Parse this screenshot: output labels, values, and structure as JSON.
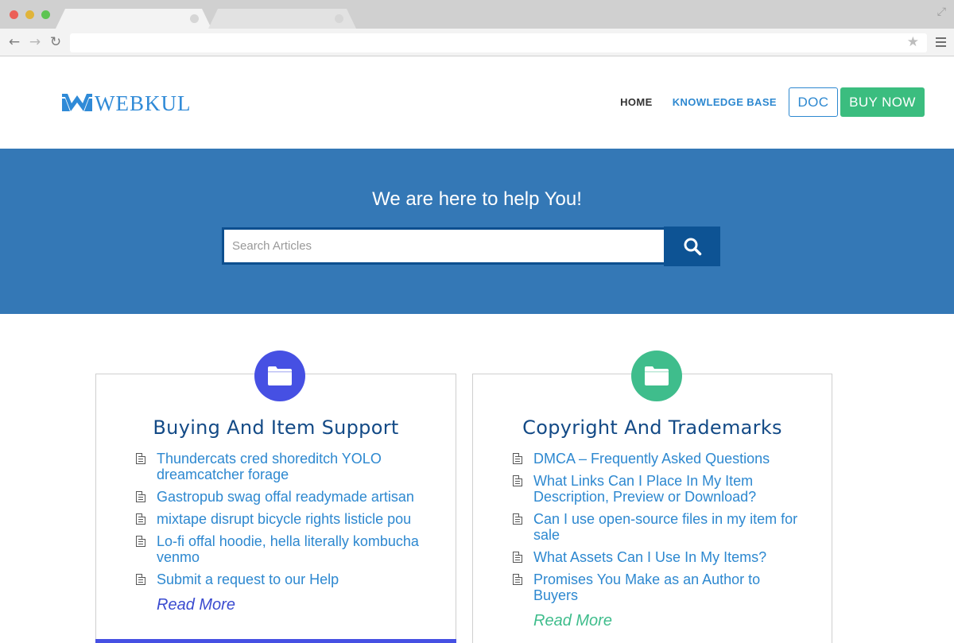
{
  "browser": {
    "icons": {
      "back": "arrow-left-icon",
      "forward": "arrow-right-icon",
      "reload": "reload-icon",
      "bookmark": "star-icon",
      "menu": "hamburger-menu-icon",
      "expand": "expand-icon"
    },
    "url": ""
  },
  "header": {
    "logo_text": "WEBKUL",
    "nav": {
      "home": "HOME",
      "knowledge_base": "KNOWLEDGE BASE",
      "doc": "DOC",
      "buy_now": "BUY NOW"
    }
  },
  "hero": {
    "title": "We are here to help You!",
    "search_placeholder": "Search Articles",
    "search_value": ""
  },
  "cards": [
    {
      "title": "Buying And Item Support",
      "icon": "folder-icon",
      "accent": "#4650e3",
      "items": [
        "Thundercats cred shoreditch YOLO dreamcatcher forage",
        "Gastropub swag offal readymade artisan",
        "mixtape disrupt bicycle rights listicle pou",
        "Lo-fi offal hoodie, hella literally kombucha venmo",
        "Submit a request to our Help"
      ],
      "read_more": "Read More"
    },
    {
      "title": "Copyright And Trademarks",
      "icon": "folder-icon",
      "accent": "#3fbd8c",
      "items": [
        "DMCA – Frequently Asked Questions",
        "What Links Can I Place In My Item Description, Preview or Download?",
        "Can I use open-source files in my item for sale",
        "What Assets Can I Use In My Items?",
        "Promises You Make as an Author to Buyers"
      ],
      "read_more": "Read More"
    }
  ],
  "colors": {
    "hero_bg": "#3478b6",
    "search_button": "#0d5394",
    "link_blue": "#2d88d0",
    "buy_green": "#3bbd7f",
    "title_navy": "#134a86"
  }
}
